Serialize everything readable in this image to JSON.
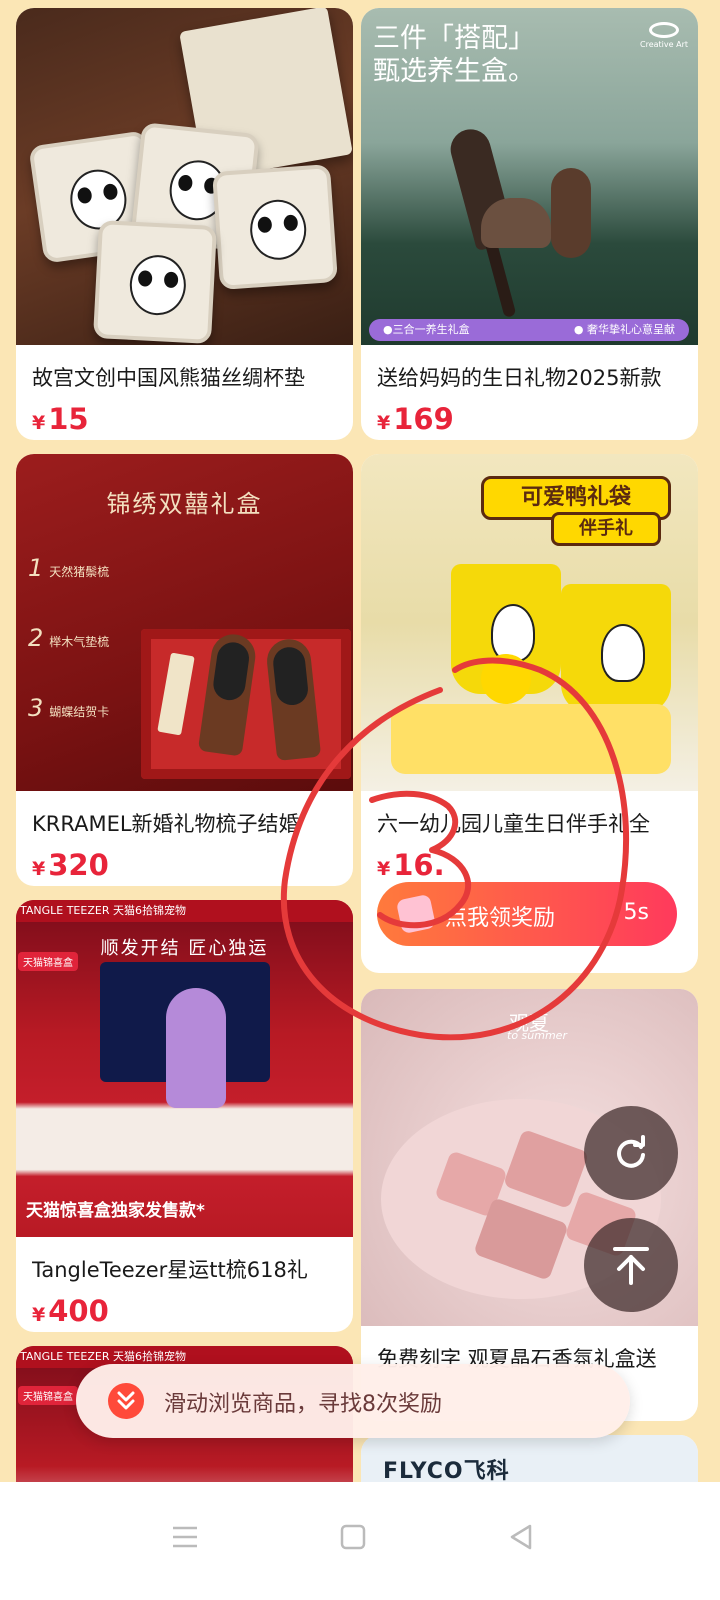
{
  "currency": "¥",
  "products": [
    {
      "title": "故宫文创中国风熊猫丝绸杯垫",
      "price": "15"
    },
    {
      "title": "送给妈妈的生日礼物2025新款",
      "price": "169",
      "image_text": {
        "headline_line1": "三件「搭配」",
        "headline_line2": "甄选养生盒。",
        "bar_left": "●三合一养生礼盒",
        "bar_right": "● 奢华挚礼心意呈献",
        "logo": "Creative Art"
      }
    },
    {
      "title": "KRRAMEL新婚礼物梳子结婚",
      "price": "320",
      "image_text": {
        "headline": "锦绣双囍礼盒",
        "feature1": "天然猪鬃梳",
        "feature2": "榉木气垫梳",
        "feature3": "蝴蝶结贺卡"
      }
    },
    {
      "title": "六一幼儿园儿童生日伴手礼全",
      "price": "16.",
      "image_text": {
        "banner1": "可爱鸭礼袋",
        "banner2": "伴手礼"
      },
      "reward_button": {
        "label": "点我领奖励",
        "countdown": "5s"
      }
    },
    {
      "title": "TangleTeezer星运tt梳618礼",
      "price": "400",
      "image_text": {
        "top": "TANGLE TEEZER 天猫6拾锦宠物",
        "headline": "顺发开结 匠心独运",
        "badge": "天猫锦喜盒",
        "bottom": "天猫惊喜盒独家发售款*"
      }
    },
    {
      "title": "免费刻字 观夏晶石香氛礼盒送",
      "price": "",
      "image_text": {
        "t1": "观夏",
        "t2": "to summer"
      }
    },
    {
      "title": "",
      "price": "",
      "image_text": {
        "top": "TANGLE TEEZER 天猫6拾锦宠物",
        "badge": "天猫锦喜盒"
      }
    },
    {
      "title": "",
      "price": "",
      "image_text": {
        "brand": "FLYCO飞科"
      }
    }
  ],
  "toast": {
    "label": "滑动浏览商品，寻找8次奖励"
  },
  "annotation": {
    "number": "3"
  },
  "colors": {
    "page_bg": "#fbe6b5",
    "price": "#e8243a",
    "accent": "#ff3a5c"
  },
  "icons": {
    "refresh": "refresh-icon",
    "back_to_top": "back-to-top-icon",
    "chevron": "double-chevron-down-icon",
    "nav_menu": "menu-icon",
    "nav_home": "home-icon",
    "nav_back": "back-icon"
  }
}
